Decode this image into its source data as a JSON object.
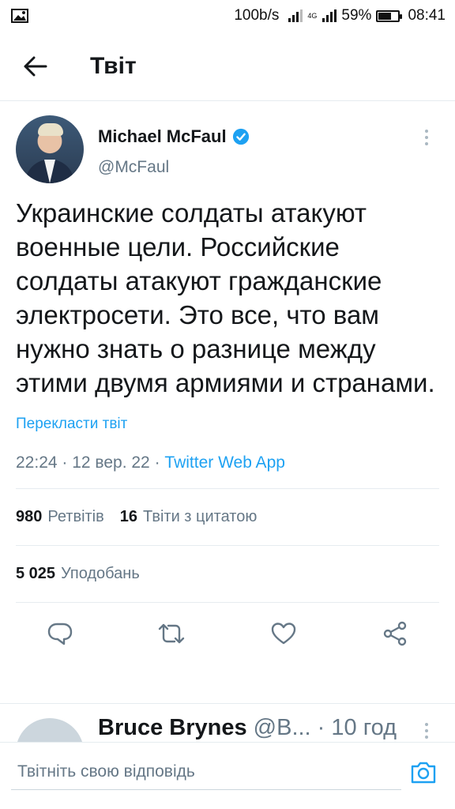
{
  "status_bar": {
    "network_speed": "100b/s",
    "network_type": "4G",
    "battery_percent": "59%",
    "battery_level": 0.59,
    "time": "08:41",
    "left_icon": "image-icon"
  },
  "header": {
    "title": "Твіт",
    "back_icon": "back-arrow-icon"
  },
  "tweet": {
    "author_name": "Michael McFaul",
    "author_handle": "@McFaul",
    "verified": true,
    "text": "Украинские солдаты атакуют военные цели. Российские солдаты атакуют гражданские электросети. Это все, что вам нужно знать о разнице между этими двумя армиями и странами.",
    "translate_label": "Перекласти твіт",
    "time": "22:24",
    "date": "12 вер. 22",
    "source": "Twitter Web App",
    "separator": " · "
  },
  "stats": {
    "retweets_count": "980",
    "retweets_label": "Ретвітів",
    "quotes_count": "16",
    "quotes_label": "Твіти з цитатою",
    "likes_count": "5 025",
    "likes_label": "Уподобань"
  },
  "actions": [
    "reply-icon",
    "retweet-icon",
    "like-icon",
    "share-icon"
  ],
  "reply_preview": {
    "name": "Bruce Brynes",
    "handle": "@B...",
    "time": "10 год"
  },
  "compose": {
    "placeholder": "Твітніть свою відповідь"
  },
  "colors": {
    "accent": "#1da1f2",
    "secondary_text": "#657786",
    "text": "#14171a",
    "divider": "#e6ecf0"
  }
}
